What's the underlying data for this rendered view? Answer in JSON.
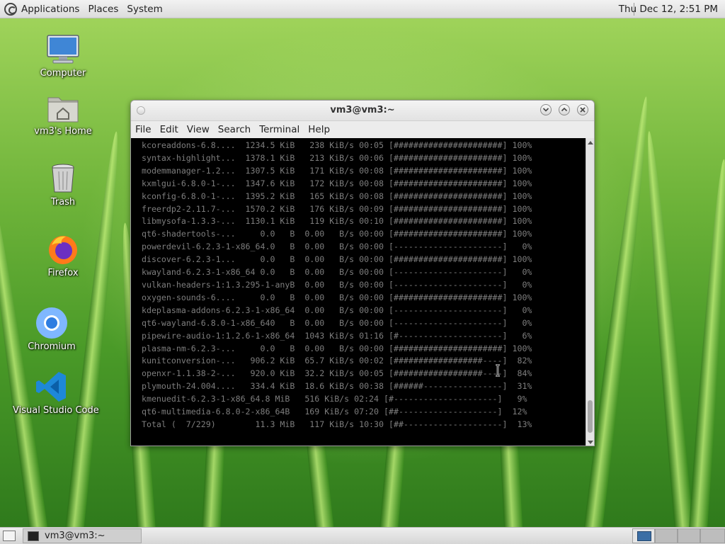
{
  "top_panel": {
    "menus": [
      "Applications",
      "Places",
      "System"
    ],
    "clock": "Thu Dec 12,  2:51 PM"
  },
  "desktop_icons": [
    {
      "label": "Computer",
      "icon": "computer-icon"
    },
    {
      "label": "vm3's Home",
      "icon": "home-folder-icon"
    },
    {
      "label": "Trash",
      "icon": "trash-icon"
    },
    {
      "label": "Firefox",
      "icon": "firefox-icon"
    },
    {
      "label": "Chromium",
      "icon": "chromium-icon"
    },
    {
      "label": "Visual Studio Code",
      "icon": "vscode-icon"
    }
  ],
  "terminal": {
    "title": "vm3@vm3:~",
    "menus": [
      "File",
      "Edit",
      "View",
      "Search",
      "Terminal",
      "Help"
    ],
    "lines": [
      " kcoreaddons-6.8....  1234.5 KiB   238 KiB/s 00:05 [######################] 100%",
      " syntax-highlight...  1378.1 KiB   213 KiB/s 00:06 [######################] 100%",
      " modemmanager-1.2...  1307.5 KiB   171 KiB/s 00:08 [######################] 100%",
      " kxmlgui-6.8.0-1-...  1347.6 KiB   172 KiB/s 00:08 [######################] 100%",
      " kconfig-6.8.0-1-...  1395.2 KiB   165 KiB/s 00:08 [######################] 100%",
      " freerdp2-2.11.7-...  1570.2 KiB   176 KiB/s 00:09 [######################] 100%",
      " libmysofa-1.3.3-...  1130.1 KiB   119 KiB/s 00:10 [######################] 100%",
      " qt6-shadertools-...     0.0   B  0.00   B/s 00:00 [######################] 100%",
      " powerdevil-6.2.3-1-x86_64.0   B  0.00   B/s 00:00 [----------------------]   0%",
      " discover-6.2.3-1...     0.0   B  0.00   B/s 00:00 [######################] 100%",
      " kwayland-6.2.3-1-x86_64 0.0   B  0.00   B/s 00:00 [----------------------]   0%",
      " vulkan-headers-1:1.3.295-1-anyB  0.00   B/s 00:00 [----------------------]   0%",
      " oxygen-sounds-6....     0.0   B  0.00   B/s 00:00 [######################] 100%",
      " kdeplasma-addons-6.2.3-1-x86_64  0.00   B/s 00:00 [----------------------]   0%",
      " qt6-wayland-6.8.0-1-x86_640   B  0.00   B/s 00:00 [----------------------]   0%",
      " pipewire-audio-1:1.2.6-1-x86_64  1043 KiB/s 01:16 [#---------------------]   6%",
      " plasma-nm-6.2.3-...     0.0   B  0.00   B/s 00:00 [######################] 100%",
      " kunitconversion-...   906.2 KiB  65.7 KiB/s 00:02 [##################----]  82%",
      " openxr-1.1.38-2-...   920.0 KiB  32.2 KiB/s 00:05 [##################----]  84%",
      " plymouth-24.004....   334.4 KiB  18.6 KiB/s 00:38 [######----------------]  31%",
      " kmenuedit-6.2.3-1-x86_64.8 MiB   516 KiB/s 02:24 [#---------------------]   9%",
      " qt6-multimedia-6.8.0-2-x86_64B   169 KiB/s 07:20 [##--------------------]  12%",
      " Total (  7/229)        11.3 MiB   117 KiB/s 10:30 [##--------------------]  13%"
    ]
  },
  "taskbar": {
    "window_button": "vm3@vm3:~"
  }
}
